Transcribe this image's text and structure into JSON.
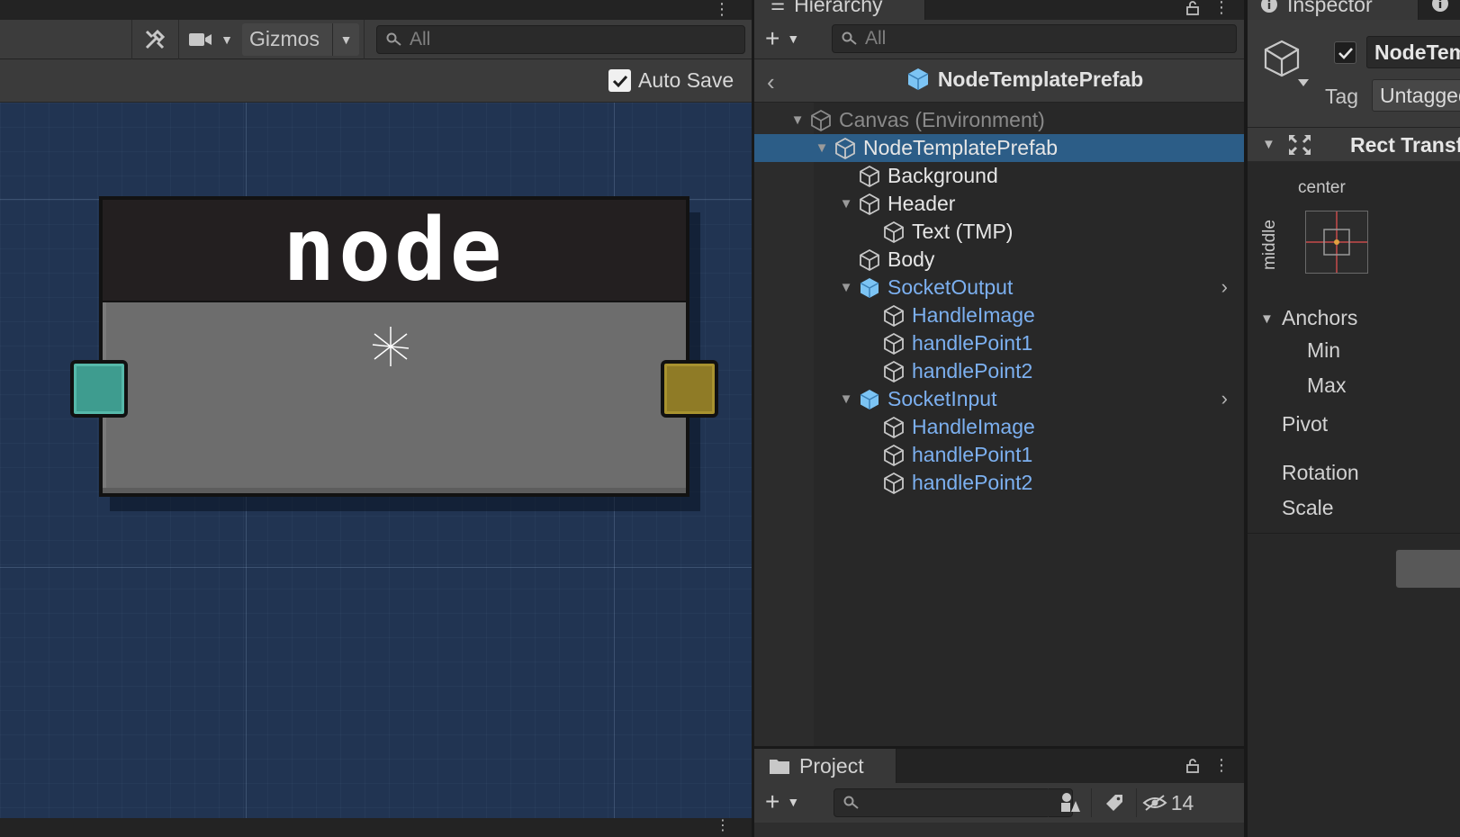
{
  "scene": {
    "toolbar": {
      "gizmos_label": "Gizmos",
      "search_placeholder": "All"
    },
    "prefab_bar": {
      "auto_save_label": "Auto Save",
      "auto_save_checked": true
    },
    "node": {
      "title": "node",
      "header_color": "#231f20",
      "body_color": "#6d6d6d",
      "input_socket_color": "#3e9c8f",
      "output_socket_color": "#8f7b26"
    },
    "background_color": "#213452"
  },
  "hierarchy": {
    "tab_label": "Hierarchy",
    "search_placeholder": "All",
    "prefab_title": "NodeTemplatePrefab",
    "rows": [
      {
        "label": "Canvas (Environment)",
        "depth": 0,
        "expanded": true,
        "style": "grey",
        "icon": "cube-outline-icon"
      },
      {
        "label": "NodeTemplatePrefab",
        "depth": 1,
        "expanded": true,
        "style": "white",
        "icon": "cube-outline-icon",
        "selected": true
      },
      {
        "label": "Background",
        "depth": 2,
        "style": "white",
        "icon": "cube-outline-icon"
      },
      {
        "label": "Header",
        "depth": 2,
        "expanded": true,
        "style": "white",
        "icon": "cube-outline-icon"
      },
      {
        "label": "Text (TMP)",
        "depth": 3,
        "style": "white",
        "icon": "cube-outline-icon"
      },
      {
        "label": "Body",
        "depth": 2,
        "style": "white",
        "icon": "cube-outline-icon"
      },
      {
        "label": "SocketOutput",
        "depth": 2,
        "expanded": true,
        "style": "blue",
        "icon": "prefab-cube-icon",
        "has_more": true
      },
      {
        "label": "HandleImage",
        "depth": 3,
        "style": "blue",
        "icon": "cube-outline-icon"
      },
      {
        "label": "handlePoint1",
        "depth": 3,
        "style": "blue",
        "icon": "cube-outline-icon"
      },
      {
        "label": "handlePoint2",
        "depth": 3,
        "style": "blue",
        "icon": "cube-outline-icon"
      },
      {
        "label": "SocketInput",
        "depth": 2,
        "expanded": true,
        "style": "blue",
        "icon": "prefab-cube-icon",
        "has_more": true
      },
      {
        "label": "HandleImage",
        "depth": 3,
        "style": "blue",
        "icon": "cube-outline-icon"
      },
      {
        "label": "handlePoint1",
        "depth": 3,
        "style": "blue",
        "icon": "cube-outline-icon"
      },
      {
        "label": "handlePoint2",
        "depth": 3,
        "style": "blue",
        "icon": "cube-outline-icon"
      }
    ]
  },
  "project": {
    "tab_label": "Project",
    "hidden_count": "14"
  },
  "inspector": {
    "tab_label": "Inspector",
    "object_name": "NodeTemplatePrefab",
    "active_checked": true,
    "tag_label": "Tag",
    "tag_value": "Untagged",
    "component_title": "Rect Transform",
    "anchor_preset": {
      "horizontal": "center",
      "vertical": "middle"
    },
    "fields": {
      "anchors": "Anchors",
      "min": "Min",
      "max": "Max",
      "pivot": "Pivot",
      "rotation": "Rotation",
      "scale": "Scale"
    }
  },
  "colors": {
    "selection": "#2c5d87",
    "prefab_blue": "#7cb0f0",
    "disabled_grey": "#8a8a8a"
  }
}
